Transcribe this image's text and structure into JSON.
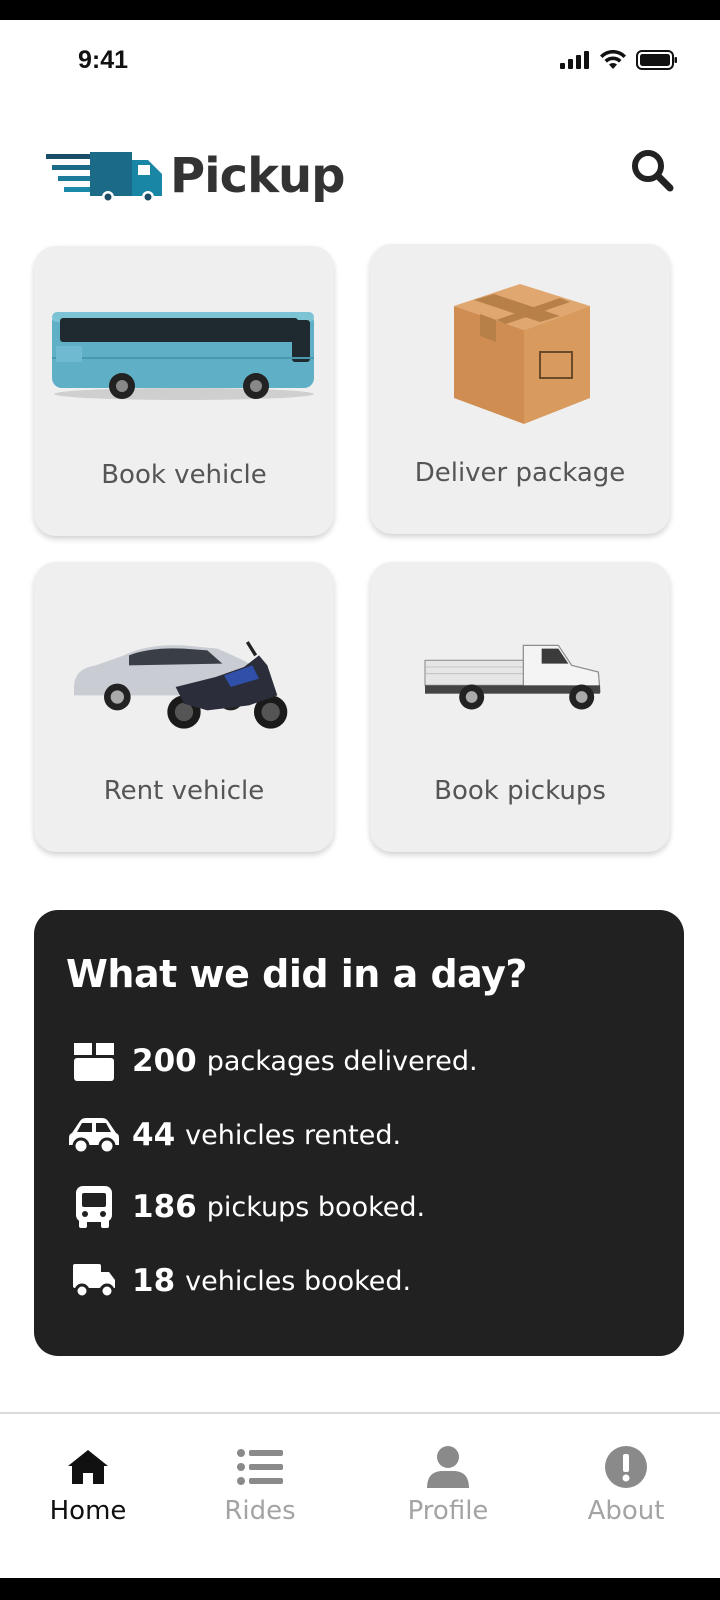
{
  "status_bar": {
    "time": "9:41"
  },
  "header": {
    "app_name": "Pickup"
  },
  "tiles": [
    {
      "label": "Book vehicle",
      "image": "bus-image"
    },
    {
      "label": "Deliver package",
      "image": "package-box-image"
    },
    {
      "label": "Rent vehicle",
      "image": "car-and-motorbike-image"
    },
    {
      "label": "Book pickups",
      "image": "pickup-truck-image"
    }
  ],
  "stats": {
    "title": "What we did in a day?",
    "rows": [
      {
        "icon": "box-icon",
        "value": "200",
        "text": "packages delivered."
      },
      {
        "icon": "car-icon",
        "value": "44",
        "text": "vehicles rented."
      },
      {
        "icon": "bus-icon",
        "value": "186",
        "text": "pickups booked."
      },
      {
        "icon": "truck-icon",
        "value": "18",
        "text": "vehicles booked."
      }
    ]
  },
  "bottom_nav": {
    "items": [
      {
        "label": "Home",
        "icon": "home-icon",
        "active": true
      },
      {
        "label": "Rides",
        "icon": "list-icon",
        "active": false
      },
      {
        "label": "Profile",
        "icon": "user-icon",
        "active": false
      },
      {
        "label": "About",
        "icon": "info-icon",
        "active": false
      }
    ]
  },
  "colors": {
    "brand_teal": "#1a7a9a",
    "logo_text": "#333333",
    "stats_bg": "#212121",
    "tile_bg": "#efefef"
  }
}
